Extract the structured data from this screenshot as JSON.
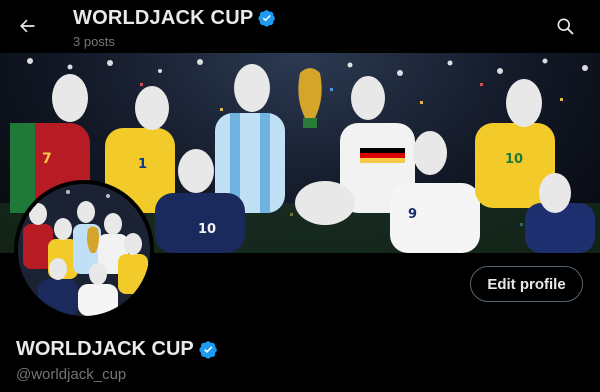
{
  "header": {
    "title": "WORLDJACK CUP",
    "posts_count": "3 posts",
    "back_icon": "arrow-left-icon",
    "search_icon": "search-icon"
  },
  "banner": {
    "description_icon": "banner-image"
  },
  "profile": {
    "display_name": "WORLDJACK CUP",
    "handle": "@worldjack_cup",
    "edit_profile_label": "Edit profile",
    "verified_badge": "verified-badge-icon"
  },
  "colors": {
    "background": "#000000",
    "primary_text": "#e7e9ea",
    "secondary_text": "#71767b",
    "verified_blue": "#1d9bf0",
    "button_border": "#536471"
  }
}
